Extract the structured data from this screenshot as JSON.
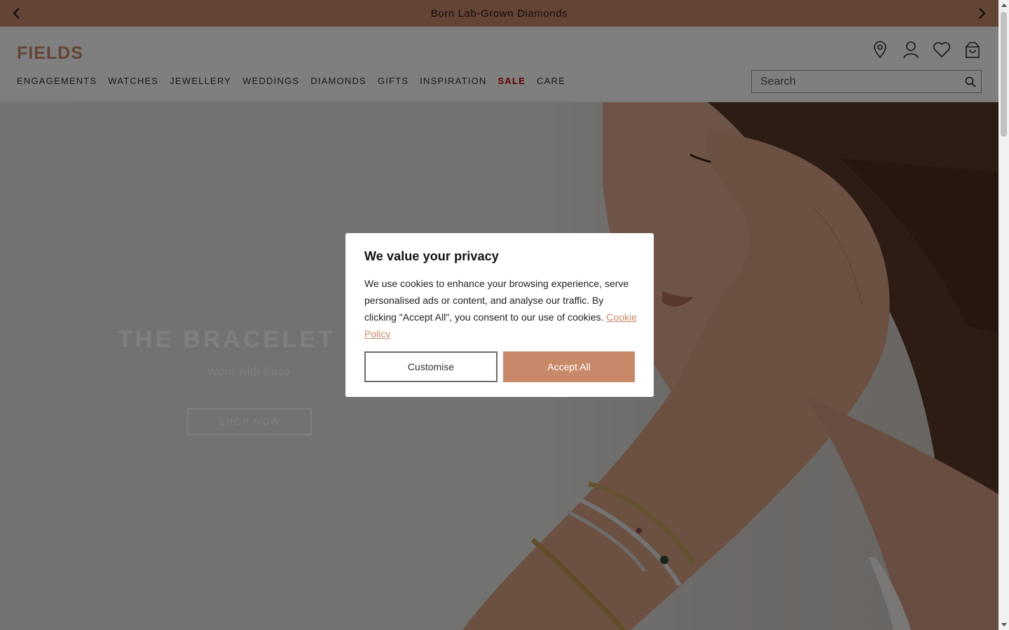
{
  "announcement": {
    "text": "Born Lab-Grown Diamonds",
    "prev_icon": "chevron-left-icon",
    "next_icon": "chevron-right-icon"
  },
  "header": {
    "logo": "FIELDS",
    "icons": [
      "location-pin-icon",
      "account-icon",
      "wishlist-heart-icon",
      "shopping-bag-icon"
    ],
    "nav": [
      {
        "label": "ENGAGEMENTS"
      },
      {
        "label": "WATCHES"
      },
      {
        "label": "JEWELLERY"
      },
      {
        "label": "WEDDINGS"
      },
      {
        "label": "DIAMONDS"
      },
      {
        "label": "GIFTS"
      },
      {
        "label": "INSPIRATION"
      },
      {
        "label": "SALE"
      },
      {
        "label": "CARE"
      }
    ],
    "search": {
      "placeholder": "Search",
      "icon": "search-icon"
    }
  },
  "hero": {
    "title": "THE BRACELET EDIT",
    "subtitle": "Worn with Ease",
    "cta": "SHOP NOW"
  },
  "cookie_modal": {
    "title": "We value your privacy",
    "body": "We use cookies to enhance your browsing experience, serve personalised ads or content, and analyse our traffic. By clicking \"Accept All\", you consent to our use of cookies.",
    "link": "Cookie Policy",
    "customise_label": "Customise",
    "accept_label": "Accept All"
  },
  "colors": {
    "brand": "#c8896a",
    "sale": "#c00000",
    "overlay": "rgba(0,0,0,0.5)"
  }
}
